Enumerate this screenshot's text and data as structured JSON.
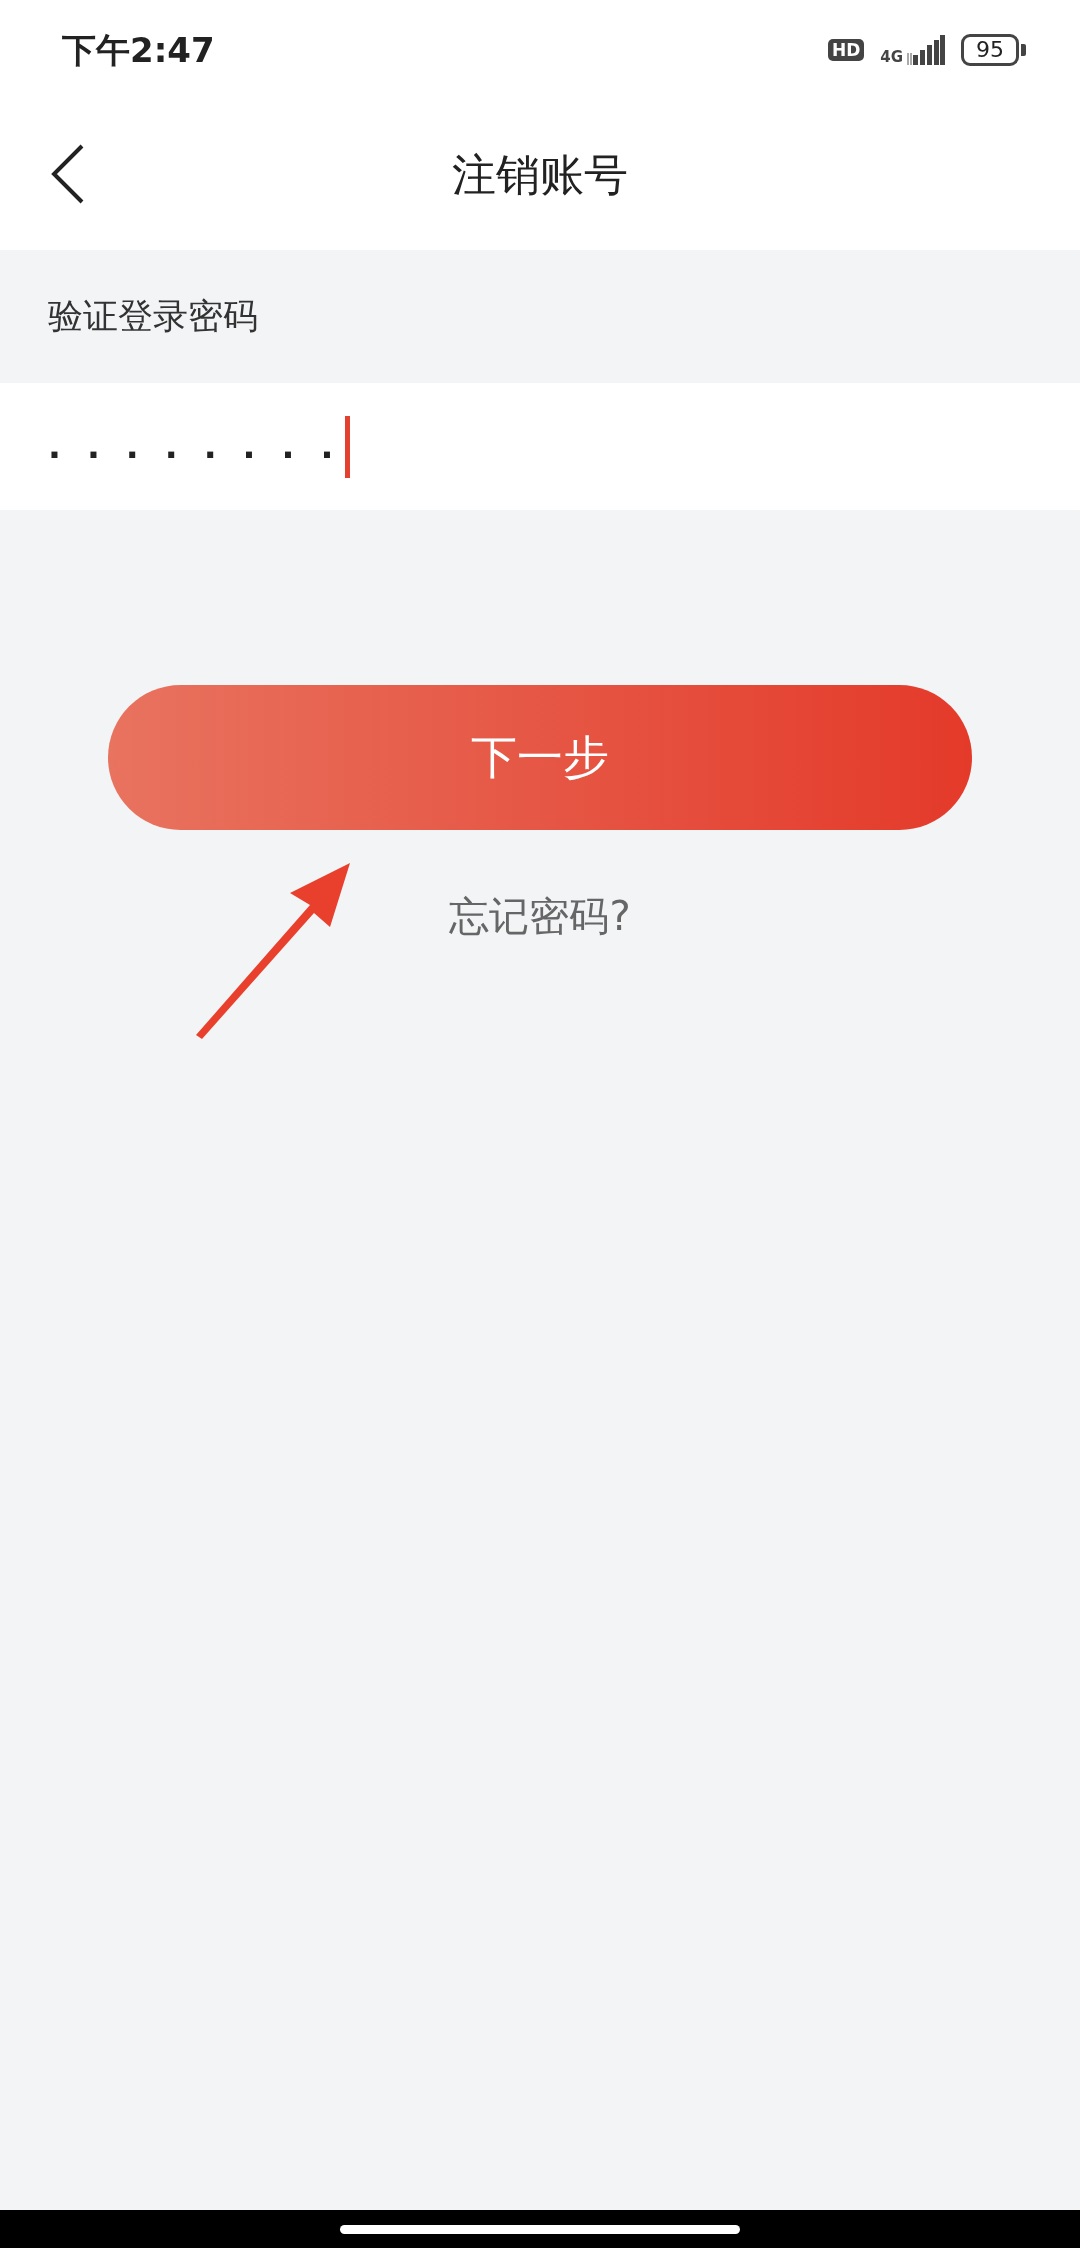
{
  "status_bar": {
    "time": "下午2:47",
    "hd": "HD",
    "network": "4G",
    "battery": "95"
  },
  "header": {
    "title": "注销账号"
  },
  "section_label": "验证登录密码",
  "password_field": {
    "value": "........",
    "focused": true
  },
  "next_button": {
    "label": "下一步"
  },
  "forgot_link": {
    "label": "忘记密码?"
  }
}
